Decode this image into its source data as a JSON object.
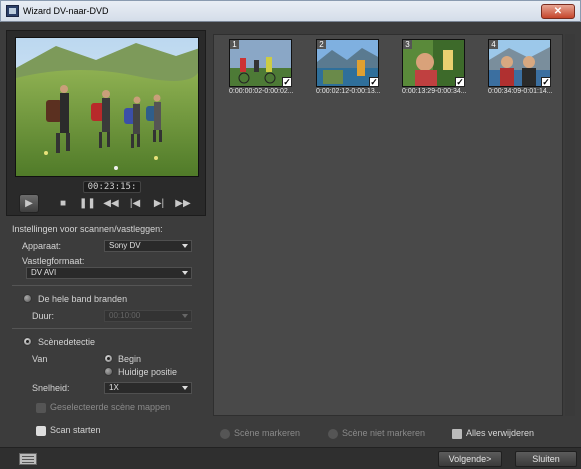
{
  "window": {
    "title": "Wizard DV-naar-DVD",
    "close_symbol": "✕"
  },
  "preview": {
    "timecode": "00:23:15:",
    "controls": [
      "play-icon",
      "stop-icon",
      "pause-icon",
      "rewind-icon",
      "previous-frame-icon",
      "next-frame-icon",
      "fast-forward-icon"
    ]
  },
  "settings": {
    "heading": "Instellingen voor scannen/vastleggen:",
    "device_label": "Apparaat:",
    "device_value": "Sony DV",
    "format_label": "Vastlegformaat:",
    "format_value": "DV AVI",
    "burn_whole_tape": "De hele band branden",
    "duration_label": "Duur:",
    "duration_value": "00:10:00",
    "scene_detection": "Scènedetectie",
    "from_label": "Van",
    "from_begin": "Begin",
    "from_current": "Huidige positie",
    "speed_label": "Snelheid:",
    "speed_value": "1X",
    "skip_selected": "Geselecteerde scène mappen",
    "start_scan": "Scan starten"
  },
  "scenes": [
    {
      "num": "1",
      "caption": "0:00:00:02-0:00:02..."
    },
    {
      "num": "2",
      "caption": "0:00:02:12-0:00:13..."
    },
    {
      "num": "3",
      "caption": "0:00:13:29-0:00:34..."
    },
    {
      "num": "4",
      "caption": "0:00:34:09-0:01:14..."
    }
  ],
  "actions": {
    "mark_scenes": "Scène markeren",
    "unmark_scenes": "Scène niet markeren",
    "remove_all": "Alles verwijderen"
  },
  "footer": {
    "next": "Volgende>",
    "close": "Sluiten"
  }
}
